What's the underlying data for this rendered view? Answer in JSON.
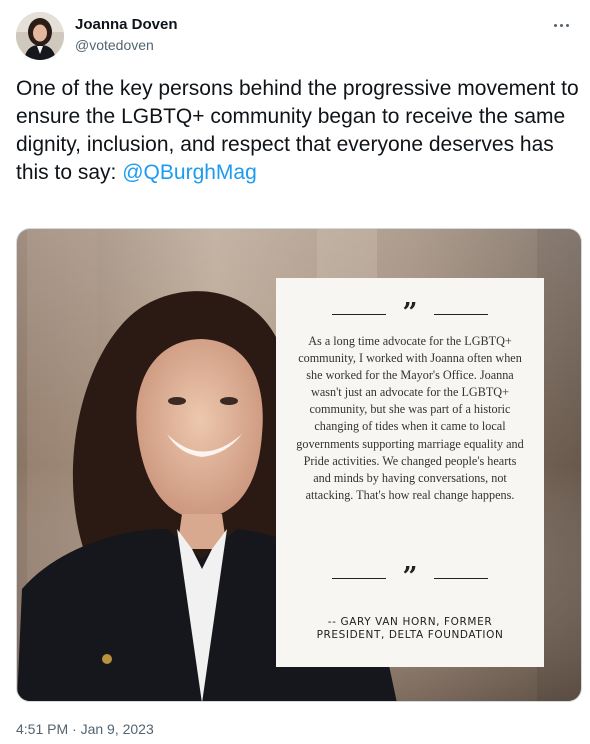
{
  "author": {
    "display_name": "Joanna Doven",
    "handle": "@votedoven"
  },
  "more_icon": "more-horizontal-icon",
  "tweet": {
    "text": "One of the key persons behind the progressive movement to ensure the LGBTQ+ community began to receive the same dignity, inclusion, and respect that everyone deserves has this to say:",
    "mention": "@QBurghMag"
  },
  "media": {
    "quote_body": "As a long time advocate for the LGBTQ+ community, I worked with Joanna often when she worked for the Mayor's Office. Joanna wasn't just an advocate for the LGBTQ+ community, but she was part of a historic changing of tides when it came to local governments supporting marriage equality and Pride activities. We changed people's hearts and minds by having conversations, not attacking. That's how real change happens.",
    "attribution": "-- GARY VAN HORN, FORMER PRESIDENT, DELTA FOUNDATION",
    "quote_glyph": "”"
  },
  "timestamp": "4:51 PM · Jan 9, 2023",
  "colors": {
    "link": "#1d9bf0",
    "secondary_text": "#536471",
    "primary_text": "#0f1419"
  }
}
